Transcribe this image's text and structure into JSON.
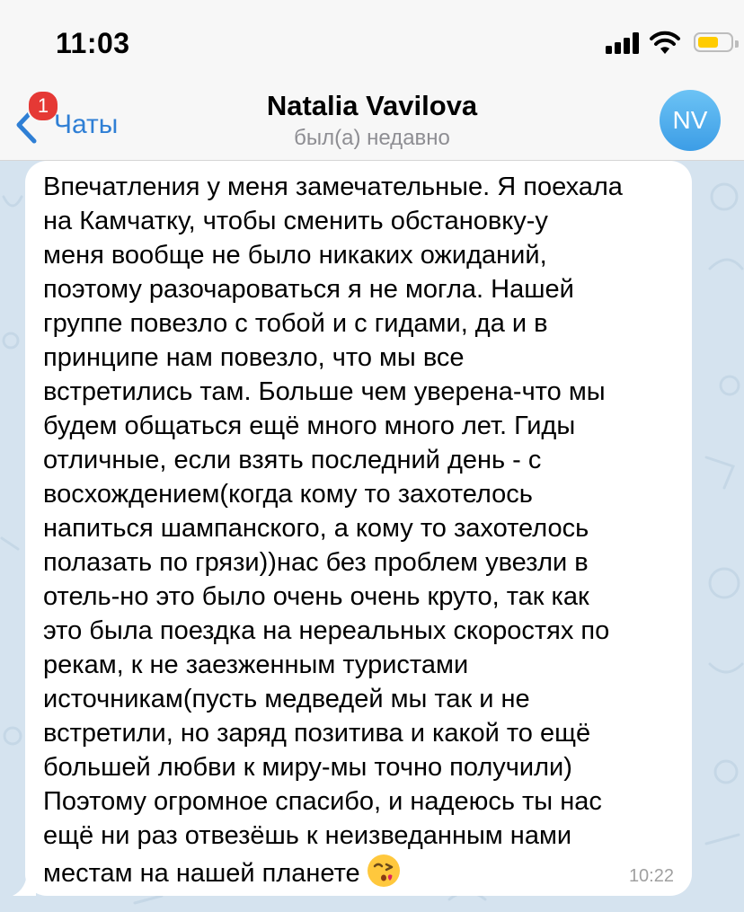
{
  "status_bar": {
    "time": "11:03",
    "icons": [
      "cellular-signal-icon",
      "wifi-icon",
      "battery-icon"
    ],
    "battery_color": "#ffcc00"
  },
  "nav": {
    "back_label": "Чаты",
    "unread_badge": "1",
    "title": "Natalia Vavilova",
    "subtitle": "был(а) недавно",
    "avatar_initials": "NV",
    "accent": "#2f7fd5",
    "badge_color": "#e53935"
  },
  "message": {
    "lines": [
      "Впечатления у меня замечательные. Я поехала",
      "на Камчатку, чтобы сменить обстановку-у",
      "меня вообще не было никаких ожиданий,",
      "поэтому разочароваться я не могла. Нашей",
      "группе повезло с тобой и с гидами, да и в",
      "принципе нам повезло, что мы все",
      "встретились там. Больше чем уверена-что мы",
      "будем общаться ещё много много лет. Гиды",
      "отличные, если взять последний день - с",
      "восхождением(когда кому то захотелось",
      "напиться шампанского, а кому то захотелось",
      "полазать по грязи))нас без проблем увезли в",
      "отель-но это было очень очень круто, так как",
      "это была поездка на нереальных скоростях по",
      "рекам, к не заезженным туристами",
      "источникам(пусть медведей мы так и не",
      "встретили, но заряд позитива и какой то ещё",
      "большей любви к миру-мы точно получили)",
      "Поэтому огромное спасибо, и надеюсь ты нас",
      "ещё ни раз отвезёшь к неизведанным нами",
      "местам на нашей планете"
    ],
    "emoji": "face-blowing-a-kiss-icon",
    "time": "10:22"
  }
}
